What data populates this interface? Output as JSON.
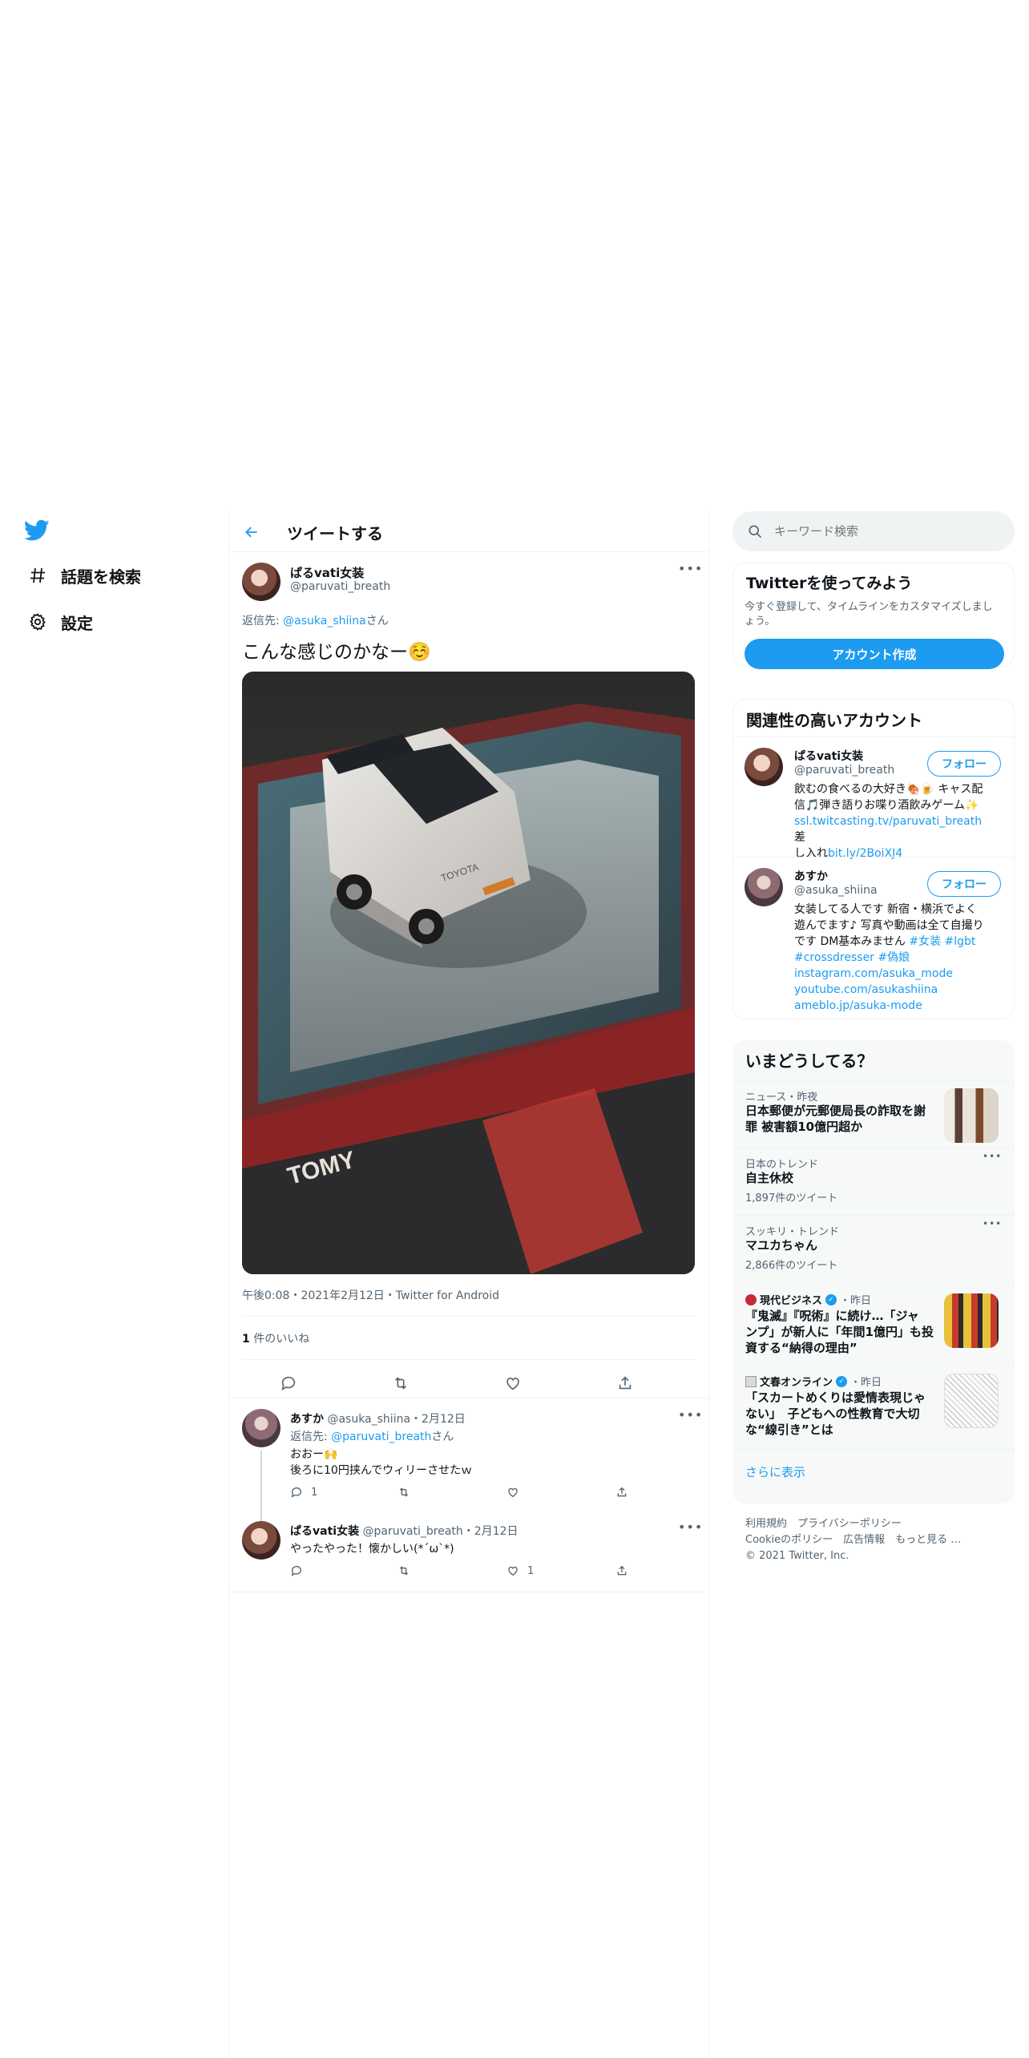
{
  "nav": {
    "explore_label": "話題を検索",
    "settings_label": "設定"
  },
  "header": {
    "title": "ツイートする"
  },
  "tweet": {
    "display_name": "ぱるvati女装",
    "handle": "@paruvati_breath",
    "reply_prefix": "返信先: ",
    "reply_to": "@asuka_shiina",
    "reply_suffix": "さん",
    "text": "こんな感じのかなー☺️",
    "meta": "午後0:08・2021年2月12日・Twitter for Android",
    "likes_count": "1",
    "likes_label": "件のいいね"
  },
  "replies": [
    {
      "display_name": "あすか",
      "handle_date": "@asuka_shiina・2月12日",
      "reply_prefix": "返信先: ",
      "reply_to": "@paruvati_breath",
      "reply_suffix": "さん",
      "line1": "おおー🙌",
      "line2": "後ろに10円挟んでウィリーさせたｗ",
      "reply_count": "1",
      "like_count": ""
    },
    {
      "display_name": "ぱるvati女装",
      "handle_date": "@paruvati_breath・2月12日",
      "line1": "やったやった！懐かしい(*ˊωˋ*)",
      "reply_count": "",
      "like_count": "1"
    }
  ],
  "search": {
    "placeholder": "キーワード検索"
  },
  "signup": {
    "title": "Twitterを使ってみよう",
    "desc": "今すぐ登録して、タイムラインをカスタマイズしましょう。",
    "button": "アカウント作成"
  },
  "related": {
    "title": "関連性の高いアカウント",
    "follow_label": "フォロー",
    "accounts": [
      {
        "name": "ぱるvati女装",
        "handle": "@paruvati_breath",
        "bio_line1": "飲むの食べるの大好き🍖🍺 キャス配",
        "bio_line2": "信🎵弾き語りお喋り酒飲みゲーム✨",
        "bio_link1": "ssl.twitcasting.tv/paruvati_breath",
        "bio_tail": "　差",
        "bio_line4": "し入れ",
        "bio_link2": "bit.ly/2BoiXJ4"
      },
      {
        "name": "あすか",
        "handle": "@asuka_shiina",
        "bio_line1": "女装してる人です 新宿・横浜でよく",
        "bio_line2": "遊んでます♪ 写真や動画は全て自撮り",
        "bio_line3": "です DM基本みません",
        "tag1": "#女装",
        "tag2": "#lgbt",
        "tag3": "#crossdresser",
        "tag4": "#偽娘",
        "link1": "instagram.com/asuka_mode",
        "link2": "youtube.com/asukashiina",
        "link3": "ameblo.jp/asuka-mode"
      }
    ]
  },
  "trends": {
    "title": "いまどうしてる？",
    "items": [
      {
        "meta": "ニュース・昨夜",
        "title_line1": "日本郵便が元郵便局長の詐取を謝",
        "title_line2": "罪 被害額10億円超か"
      },
      {
        "meta": "日本のトレンド",
        "title_line1": "自主休校",
        "count": "1,897件のツイート"
      },
      {
        "meta": "スッキリ・トレンド",
        "title_line1": "マユカちゃん",
        "count": "2,866件のツイート"
      },
      {
        "source": "現代ビジネス",
        "time": "・昨日",
        "title_line1": "『鬼滅』『呪術』に続け…「ジャ",
        "title_line2": "ンプ」が新人に「年間1億円」も投",
        "title_line3": "資する“納得の理由”"
      },
      {
        "source": "文春オンライン",
        "time": "・昨日",
        "title_line1": "「スカートめくりは愛情表現じゃ",
        "title_line2": "ない」　子どもへの性教育で大切",
        "title_line3": "な“線引き”とは"
      }
    ],
    "show_more": "さらに表示"
  },
  "footer": {
    "line1": "利用規約　プライバシーポリシー",
    "line2": "Cookieのポリシー　広告情報　もっと見る …",
    "line3": "© 2021 Twitter, Inc."
  },
  "colors": {
    "accent": "#1d9bf0",
    "muted": "#536471",
    "divider": "#eff3f4",
    "panel": "#f7f9f9"
  }
}
